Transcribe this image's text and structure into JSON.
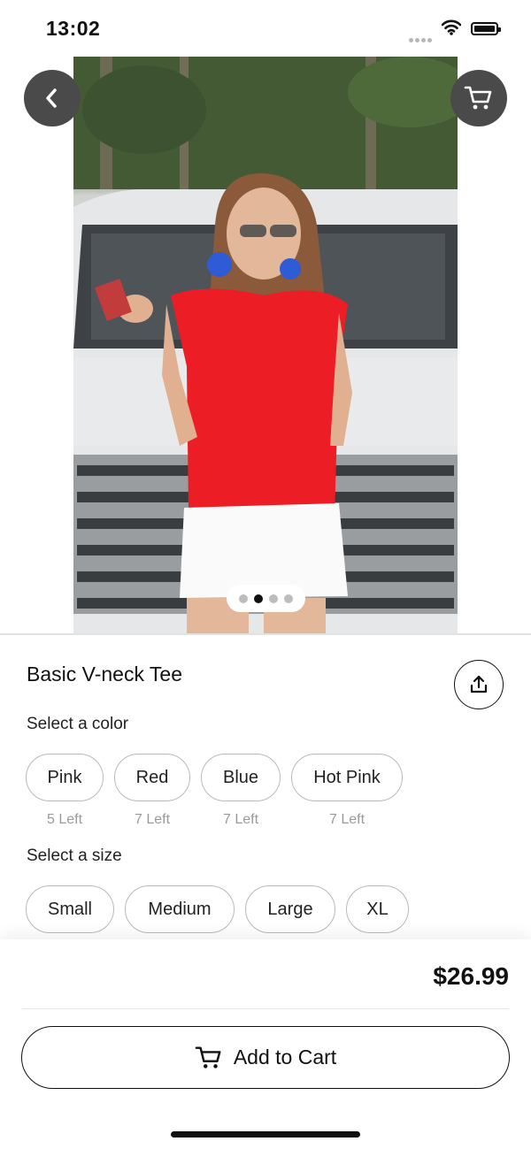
{
  "status": {
    "time": "13:02"
  },
  "product": {
    "title": "Basic V-neck Tee",
    "price": "$26.99"
  },
  "colors": {
    "label": "Select a color",
    "options": [
      {
        "label": "Pink",
        "stock": "5 Left"
      },
      {
        "label": "Red",
        "stock": "7 Left"
      },
      {
        "label": "Blue",
        "stock": "7 Left"
      },
      {
        "label": "Hot Pink",
        "stock": "7 Left"
      }
    ]
  },
  "sizes": {
    "label": "Select a size",
    "options": [
      "Small",
      "Medium",
      "Large",
      "XL"
    ]
  },
  "carousel": {
    "pages": 4,
    "active_index": 1
  },
  "actions": {
    "add_to_cart": "Add to Cart"
  },
  "icons": {
    "back": "chevron-left-icon",
    "cart": "cart-icon",
    "share": "share-icon"
  },
  "theme": {
    "nav_button_bg": "#4a4a4a",
    "accent": "#111111"
  }
}
